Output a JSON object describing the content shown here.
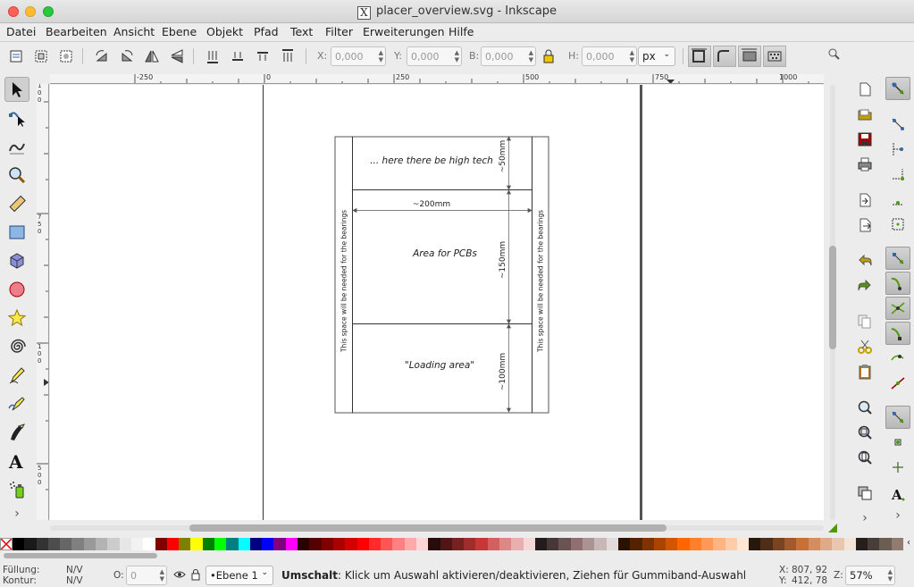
{
  "window": {
    "title": "placer_overview.svg - Inkscape",
    "x_badge": "X",
    "traffic": {
      "close": "#fe5f57",
      "minimize": "#febc2e",
      "zoom": "#28c840"
    }
  },
  "menu": [
    "Datei",
    "Bearbeiten",
    "Ansicht",
    "Ebene",
    "Objekt",
    "Pfad",
    "Text",
    "Filter",
    "Erweiterungen",
    "Hilfe"
  ],
  "toolbar": {
    "x_label": "X:",
    "x_value": "0,000",
    "y_label": "Y:",
    "y_value": "0,000",
    "w_label": "B:",
    "w_value": "0,000",
    "h_label": "H:",
    "h_value": "0,000",
    "unit": "px"
  },
  "rulers": {
    "h_ticks": [
      "-250",
      "0",
      "250",
      "500",
      "750",
      "1000"
    ],
    "v_ticks": [
      "100",
      "750",
      "500"
    ]
  },
  "drawing": {
    "top_label": "... here there be high tech",
    "top_dim": "~50mm",
    "width_dim": "~200mm",
    "middle_label": "Area for PCBs",
    "middle_dim": "~150mm",
    "bottom_label": "\"Loading area\"",
    "bottom_dim": "~100mm",
    "side_left": "This space will be needed for the bearings",
    "side_right": "This space will be needed for the bearings"
  },
  "palette_colors": [
    "#000000",
    "#1a1a1a",
    "#333333",
    "#4d4d4d",
    "#666666",
    "#808080",
    "#999999",
    "#b3b3b3",
    "#cccccc",
    "#e6e6e6",
    "#f2f2f2",
    "#ffffff",
    "#800000",
    "#ff0000",
    "#808000",
    "#ffff00",
    "#008000",
    "#00ff00",
    "#008080",
    "#00ffff",
    "#000080",
    "#0000ff",
    "#800080",
    "#ff00ff",
    "#2b0000",
    "#550000",
    "#800000",
    "#aa0000",
    "#d40000",
    "#ff0000",
    "#ff2a2a",
    "#ff5555",
    "#ff8080",
    "#ffaaaa",
    "#ffd5d5",
    "#280b0b",
    "#501616",
    "#782121",
    "#a02c2c",
    "#c83737",
    "#d35f5f",
    "#de8787",
    "#e9afaf",
    "#f4d7d7",
    "#241c1c",
    "#483737",
    "#6c5353",
    "#916f6f",
    "#ac9393",
    "#c8b7b7",
    "#e3dbdb",
    "#2b1100",
    "#552200",
    "#803300",
    "#aa4400",
    "#d45500",
    "#ff6600",
    "#ff7f2a",
    "#ff9955",
    "#ffb380",
    "#ffccaa",
    "#ffe6d5",
    "#28170b",
    "#502d16",
    "#784421",
    "#a05a2c",
    "#c87137",
    "#d38d5f",
    "#deaa87",
    "#e9c6af",
    "#f4e3d7",
    "#241f1c",
    "#483e37",
    "#6c5d53",
    "#917c6f"
  ],
  "status": {
    "fill_label": "Füllung:",
    "fill_value": "N/V",
    "stroke_label": "Kontur:",
    "stroke_value": "N/V",
    "opacity_label": "O:",
    "opacity_value": "0",
    "layer": "•Ebene 1",
    "message_bold": "Umschalt",
    "message": ": Klick um Auswahl aktivieren/deaktivieren, Ziehen für Gummiband-Auswahl",
    "x_label": "X:",
    "x_value": "807, 92",
    "y_label": "Y:",
    "y_value": "412, 78",
    "zoom_label": "Z:",
    "zoom_value": "57%"
  }
}
